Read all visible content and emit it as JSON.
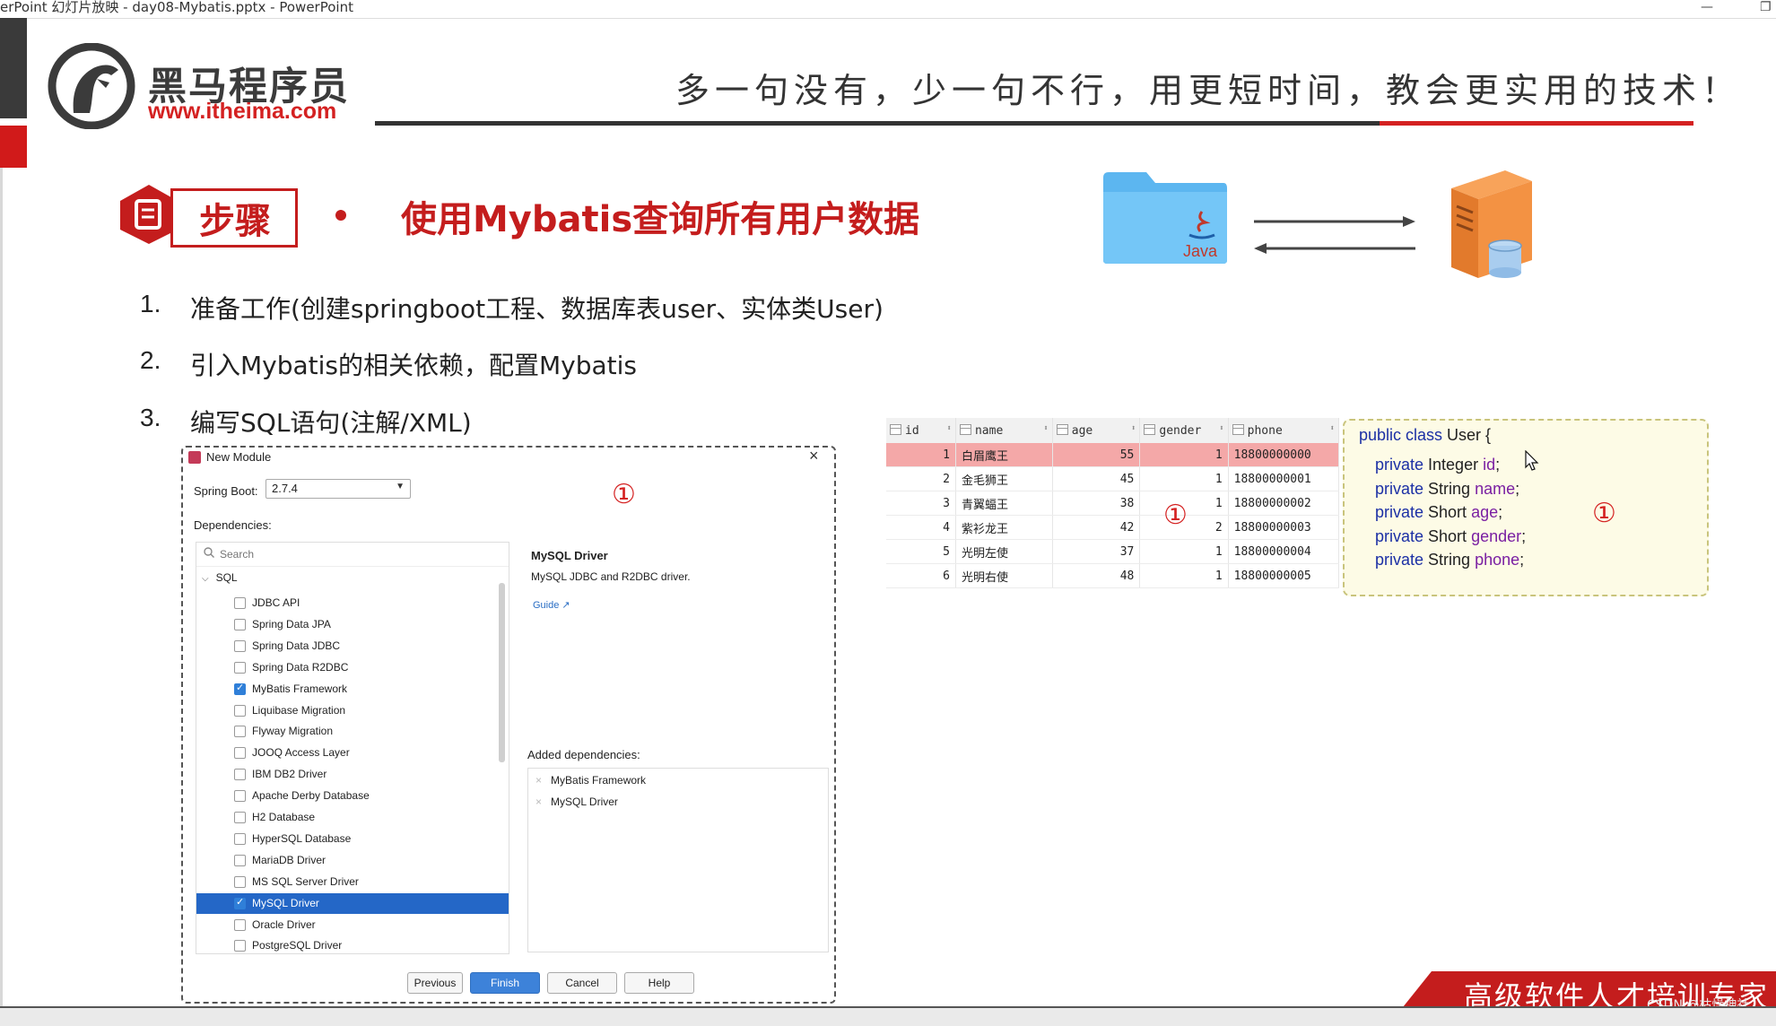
{
  "window": {
    "title": "erPoint 幻灯片放映  -  day08-Mybatis.pptx  -  PowerPoint",
    "minimize_glyph": "—",
    "restore_glyph": "❐"
  },
  "brand": {
    "name_cn": "黑马程序员",
    "url": "www.itheima.com",
    "logo_icon": "horse-head-logo"
  },
  "slogan": "多一句没有，少一句不行，用更短时间，教会更实用的技术！",
  "section": {
    "badge_label": "步骤",
    "badge_icon": "document-icon",
    "heading": "使用Mybatis查询所有用户数据"
  },
  "steps": [
    {
      "num": "1.",
      "text": "准备工作(创建springboot工程、数据库表user、实体类User)"
    },
    {
      "num": "2.",
      "text": "引入Mybatis的相关依赖，配置Mybatis"
    },
    {
      "num": "3.",
      "text": "编写SQL语句(注解/XML)"
    }
  ],
  "diagram": {
    "folder_label": "Java",
    "folder_icon": "java-folder-icon",
    "server_icon": "database-server-icon"
  },
  "marker": "①",
  "dialog": {
    "title": "New Module",
    "spring_boot_label": "Spring Boot:",
    "spring_boot_value": "2.7.4",
    "dependencies_label": "Dependencies:",
    "search_placeholder": "Search",
    "group": "SQL",
    "items": [
      {
        "label": "JDBC API",
        "checked": false
      },
      {
        "label": "Spring Data JPA",
        "checked": false
      },
      {
        "label": "Spring Data JDBC",
        "checked": false
      },
      {
        "label": "Spring Data R2DBC",
        "checked": false
      },
      {
        "label": "MyBatis Framework",
        "checked": true
      },
      {
        "label": "Liquibase Migration",
        "checked": false
      },
      {
        "label": "Flyway Migration",
        "checked": false
      },
      {
        "label": "JOOQ Access Layer",
        "checked": false
      },
      {
        "label": "IBM DB2 Driver",
        "checked": false
      },
      {
        "label": "Apache Derby Database",
        "checked": false
      },
      {
        "label": "H2 Database",
        "checked": false
      },
      {
        "label": "HyperSQL Database",
        "checked": false
      },
      {
        "label": "MariaDB Driver",
        "checked": false
      },
      {
        "label": "MS SQL Server Driver",
        "checked": false
      },
      {
        "label": "MySQL Driver",
        "checked": true,
        "selected": true
      },
      {
        "label": "Oracle Driver",
        "checked": false
      },
      {
        "label": "PostgreSQL Driver",
        "checked": false
      }
    ],
    "detail_title": "MySQL Driver",
    "detail_desc": "MySQL JDBC and R2DBC driver.",
    "guide_link": "Guide ↗",
    "added_label": "Added dependencies:",
    "added": [
      "MyBatis Framework",
      "MySQL Driver"
    ],
    "buttons": {
      "previous": "Previous",
      "finish": "Finish",
      "cancel": "Cancel",
      "help": "Help"
    }
  },
  "db_table": {
    "columns": [
      "id",
      "name",
      "age",
      "gender",
      "phone"
    ],
    "rows": [
      [
        "1",
        "白眉鹰王",
        "55",
        "1",
        "18800000000"
      ],
      [
        "2",
        "金毛狮王",
        "45",
        "1",
        "18800000001"
      ],
      [
        "3",
        "青翼蝠王",
        "38",
        "1",
        "18800000002"
      ],
      [
        "4",
        "紫衫龙王",
        "42",
        "2",
        "18800000003"
      ],
      [
        "5",
        "光明左使",
        "37",
        "1",
        "18800000004"
      ],
      [
        "6",
        "光明右使",
        "48",
        "1",
        "18800000005"
      ]
    ]
  },
  "code": {
    "header": {
      "kw": "public class",
      "rest": " User {"
    },
    "fields": [
      {
        "kw": "private",
        "type": " Integer ",
        "name": "id",
        "end": ";"
      },
      {
        "kw": "private",
        "type": " String ",
        "name": "name",
        "end": ";"
      },
      {
        "kw": "private",
        "type": " Short ",
        "name": "age",
        "end": ";"
      },
      {
        "kw": "private",
        "type": " Short ",
        "name": "gender",
        "end": ";"
      },
      {
        "kw": "private",
        "type": " String ",
        "name": "phone",
        "end": ";"
      }
    ]
  },
  "footer": {
    "banner": "高级软件人才培训专家",
    "watermark": "CSDN @枯燥神社"
  },
  "colors": {
    "brand_red": "#d42121",
    "selection_blue": "#2467c7",
    "highlight_row": "#f4a8a8"
  }
}
